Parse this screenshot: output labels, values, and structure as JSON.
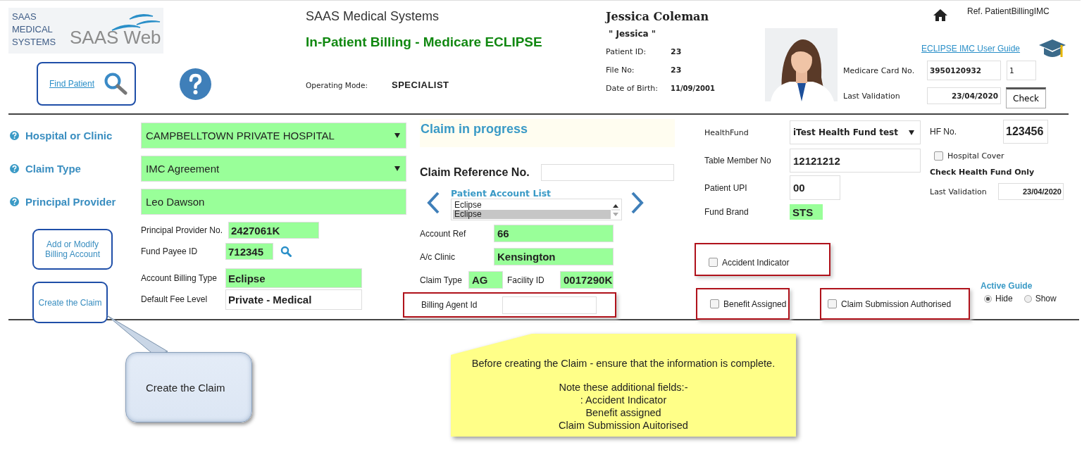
{
  "header": {
    "logo": {
      "lines": [
        "SAAS",
        "MEDICAL",
        "SYSTEMS"
      ],
      "wordmark": "SAAS Web"
    },
    "find_patient": "Find Patient",
    "company": "SAAS Medical Systems",
    "title": "In-Patient Billing - Medicare ECLIPSE",
    "operating_mode": {
      "label": "Operating Mode:",
      "value": "SPECIALIST"
    },
    "ref": "Ref. PatientBillingIMC",
    "guide_link": "ECLIPSE IMC User Guide"
  },
  "patient": {
    "name": "Jessica Coleman",
    "nickname": "\" Jessica \"",
    "fields": [
      {
        "label": "Patient ID:",
        "value": "23"
      },
      {
        "label": "File No:",
        "value": "23"
      },
      {
        "label": "Date of Birth:",
        "value": "11/09/2001"
      }
    ]
  },
  "medicare": {
    "card_label": "Medicare Card No.",
    "card_no": "3950120932",
    "irn": "1",
    "validation_label": "Last Validation",
    "validation": "23/04/2020",
    "check_button": "Check"
  },
  "claim_form": {
    "main_fields": [
      {
        "label": "Hospital or Clinic",
        "value": "CAMPBELLTOWN PRIVATE HOSPITAL",
        "kind": "select"
      },
      {
        "label": "Claim Type",
        "value": "IMC Agreement",
        "kind": "select"
      },
      {
        "label": "Principal Provider",
        "value": "Leo Dawson",
        "kind": "text"
      }
    ],
    "buttons": [
      "Add or Modify Billing Account",
      "Create the Claim"
    ],
    "sub_fields": [
      {
        "label": "Principal Provider No.",
        "value": "2427061K",
        "highlight": true,
        "search": false
      },
      {
        "label": "Fund Payee ID",
        "value": "712345",
        "highlight": true,
        "search": true
      },
      {
        "label": "Account Billing Type",
        "value": "Eclipse",
        "highlight": true,
        "search": false
      },
      {
        "label": "Default Fee Level",
        "value": "Private - Medical",
        "highlight": false,
        "search": false
      }
    ]
  },
  "claim": {
    "status": "Claim in progress",
    "reference_label": "Claim Reference No.",
    "account_list": {
      "title": "Patient Account List",
      "items": [
        {
          "label": "Eclipse",
          "selected": false
        },
        {
          "label": "Eclipse",
          "selected": true
        }
      ]
    },
    "account_rows": [
      {
        "fields": [
          {
            "label": "Account Ref",
            "value": "66",
            "highlight": true
          }
        ]
      },
      {
        "fields": [
          {
            "label": "A/c Clinic",
            "value": "Kensington",
            "highlight": true
          }
        ]
      },
      {
        "fields": [
          {
            "label": "Claim Type",
            "value": "AG",
            "highlight": true
          },
          {
            "label": "Facility ID",
            "value": "0017290K",
            "highlight": true
          }
        ]
      }
    ],
    "billing_agent": {
      "label": "Billing Agent Id",
      "flagged": true
    }
  },
  "health_fund": {
    "fields": [
      {
        "label": "HealthFund",
        "value": "iTest Health Fund test",
        "kind": "select",
        "highlight": false
      },
      {
        "label": "Table Member No",
        "value": "12121212",
        "kind": "text",
        "highlight": false
      },
      {
        "label": "Patient UPI",
        "value": "00",
        "kind": "text",
        "highlight": false
      },
      {
        "label": "Fund Brand",
        "value": "STS",
        "kind": "text",
        "highlight": true
      }
    ],
    "hf_no": {
      "label": "HF No.",
      "value": "123456"
    },
    "hospital_cover": {
      "label": "Hospital Cover",
      "checked": false
    },
    "check_only": "Check Health Fund Only",
    "validation": {
      "label": "Last Validation",
      "value": "23/04/2020"
    }
  },
  "flags": [
    {
      "label": "Accident Indicator",
      "checked": false,
      "flagged": true
    },
    {
      "label": "Benefit Assigned",
      "checked": false,
      "flagged": true
    },
    {
      "label": "Claim Submission Authorised",
      "checked": false,
      "flagged": true
    }
  ],
  "active_guide": {
    "title": "Active Guide",
    "options": [
      {
        "label": "Hide",
        "selected": true
      },
      {
        "label": "Show",
        "selected": false
      }
    ]
  },
  "callouts": {
    "tooltip": "Create the Claim",
    "note": [
      "Before creating the Claim - ensure that the information is complete.",
      "Note these additional fields:-",
      ": Accident Indicator",
      "Benefit assigned",
      "Claim Submission Auitorised"
    ]
  }
}
